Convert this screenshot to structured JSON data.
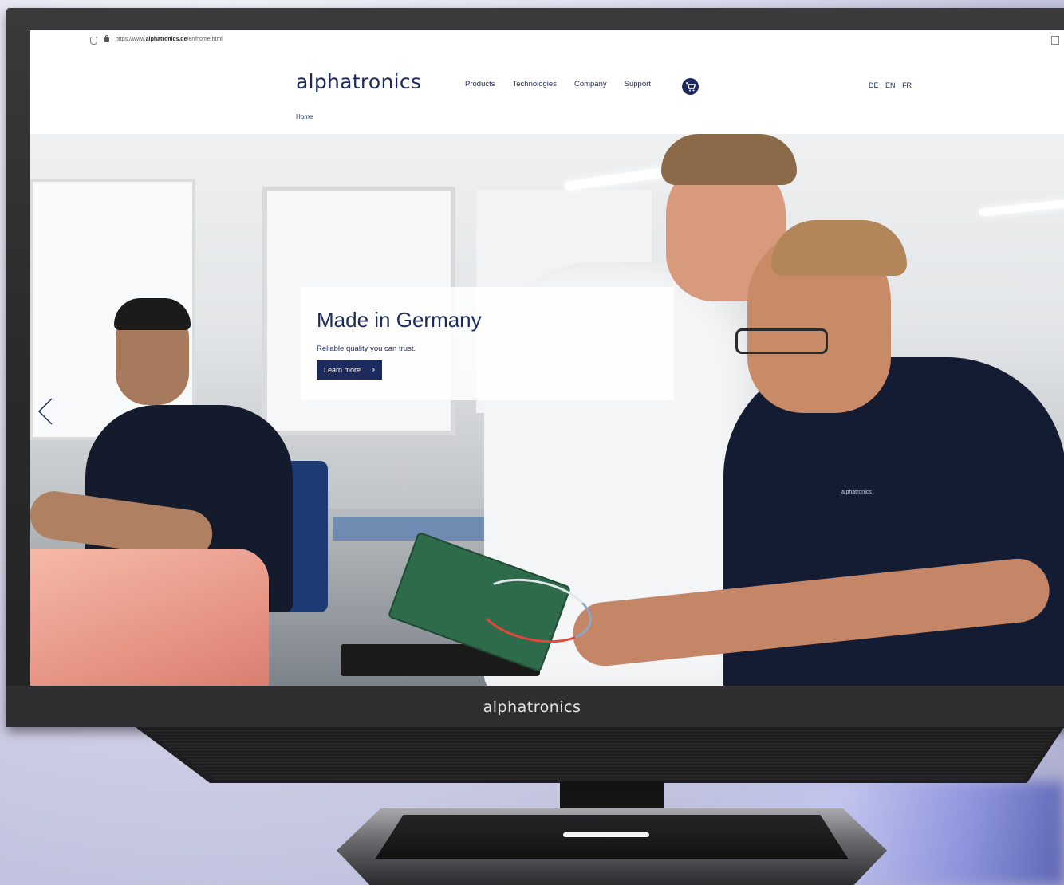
{
  "browser": {
    "url_prefix": "https://www.",
    "url_domain": "alphatronics.de",
    "url_path": "/en/home.html"
  },
  "site": {
    "logo": "alphatronics",
    "nav": [
      "Products",
      "Technologies",
      "Company",
      "Support"
    ],
    "languages": [
      "DE",
      "EN",
      "FR"
    ],
    "breadcrumb": "Home"
  },
  "hero": {
    "title": "Made in Germany",
    "subtitle": "Reliable quality you can trust.",
    "button_label": "Learn more",
    "button_chevron": "›",
    "prev_icon": "chevron-left-icon",
    "shirt_logo": "alphatronics"
  },
  "monitor": {
    "brand": "alphatronics"
  },
  "colors": {
    "brand": "#1d2b5c",
    "accent": "#1d2b5c"
  }
}
